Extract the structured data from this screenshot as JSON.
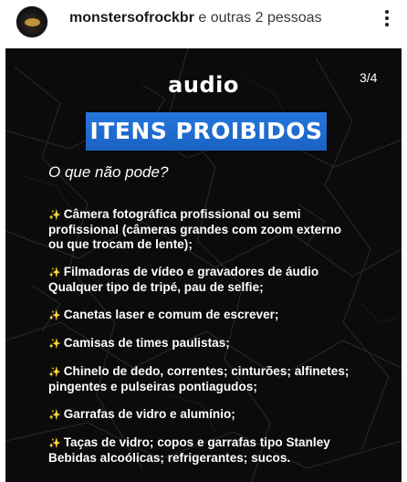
{
  "header": {
    "username": "monstersofrockbr",
    "suffix": " e outras 2 pessoas",
    "avatar_icon": "monsters-of-rock-avatar",
    "more_icon": "more-vertical-icon"
  },
  "post": {
    "logo": "audio",
    "page_indicator": "3/4",
    "title": "ITENS PROIBIDOS",
    "subtitle": "O que não pode?",
    "bullet_icon": "sparkle-icon",
    "title_color": "#1f6fd6",
    "items": [
      {
        "bullet": "✨",
        "lines": [
          "Câmera fotográfica profissional ou semi",
          "profissional (câmeras grandes com zoom externo",
          "ou que trocam de lente);"
        ]
      },
      {
        "bullet": "✨",
        "lines": [
          "Filmadoras de vídeo e gravadores de áudio",
          "Qualquer tipo de tripé, pau de selfie;"
        ]
      },
      {
        "bullet": "✨",
        "lines": [
          "Canetas laser e comum de escrever;"
        ]
      },
      {
        "bullet": "✨",
        "lines": [
          "Camisas de times paulistas;"
        ]
      },
      {
        "bullet": "✨",
        "lines": [
          "Chinelo de dedo, correntes; cinturões; alfinetes;",
          "pingentes e pulseiras pontiagudos;"
        ]
      },
      {
        "bullet": "✨",
        "lines": [
          "Garrafas de vidro e alumínio;"
        ]
      },
      {
        "bullet": "✨",
        "lines": [
          "Taças de vidro; copos e garrafas tipo Stanley",
          "Bebidas alcoólicas; refrigerantes; sucos."
        ]
      }
    ]
  }
}
